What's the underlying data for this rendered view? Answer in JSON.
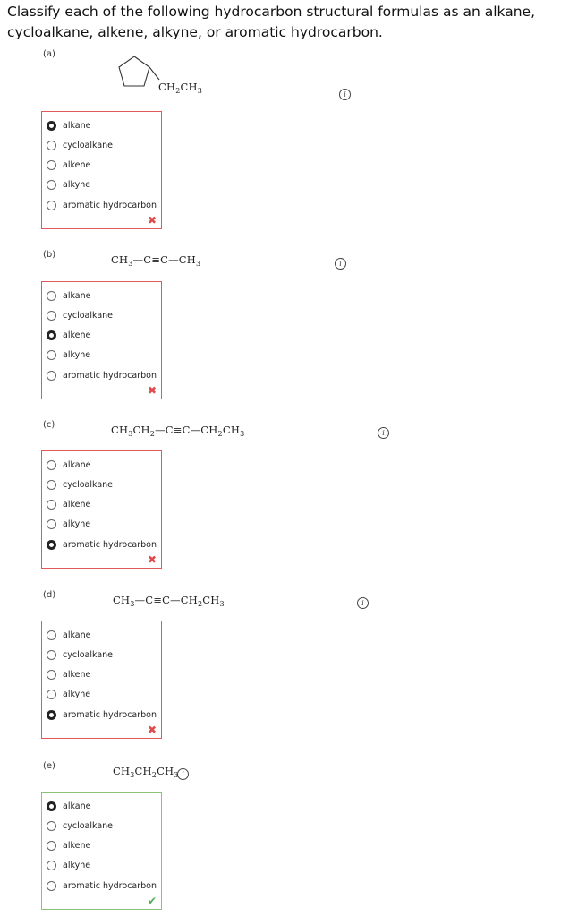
{
  "question": "Classify each of the following hydrocarbon structural formulas as an alkane, cycloalkane, alkene, alkyne, or aromatic hydrocarbon.",
  "info_glyph": "i",
  "options": [
    "alkane",
    "cycloalkane",
    "alkene",
    "alkyne",
    "aromatic hydrocarbon"
  ],
  "parts": [
    {
      "label": "(a)",
      "formula_html": "CH<sub>2</sub>CH<sub>3</sub>",
      "selected": "alkane",
      "status": "incorrect",
      "status_symbol": "✖"
    },
    {
      "label": "(b)",
      "formula_html": "CH<sub>3</sub>—C≡C—CH<sub>3</sub>",
      "selected": "alkene",
      "status": "incorrect",
      "status_symbol": "✖"
    },
    {
      "label": "(c)",
      "formula_html": "CH<sub>3</sub>CH<sub>2</sub>—C≡C—CH<sub>2</sub>CH<sub>3</sub>",
      "selected": "aromatic hydrocarbon",
      "status": "incorrect",
      "status_symbol": "✖"
    },
    {
      "label": "(d)",
      "formula_html": "CH<sub>3</sub>—C≡C—CH<sub>2</sub>CH<sub>3</sub>",
      "selected": "aromatic hydrocarbon",
      "status": "incorrect",
      "status_symbol": "✖"
    },
    {
      "label": "(e)",
      "formula_html": "CH<sub>3</sub>CH<sub>2</sub>CH<sub>3</sub>",
      "selected": "alkane",
      "status": "correct",
      "status_symbol": "✔"
    }
  ]
}
